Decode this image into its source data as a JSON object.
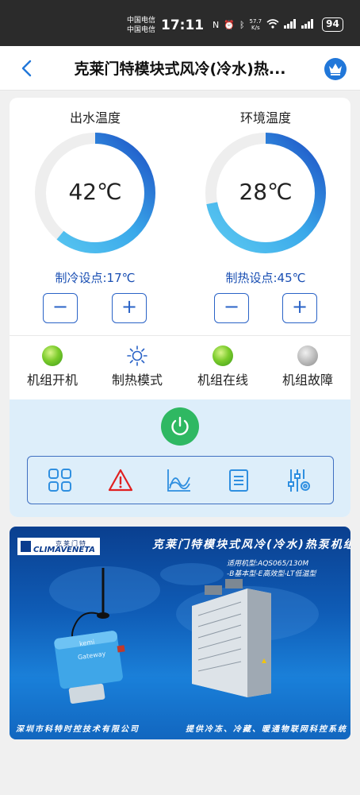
{
  "status_bar": {
    "carrier1": "中国电信",
    "carrier2": "中国电信",
    "time": "17:11",
    "net_speed_value": "57.7",
    "net_speed_unit": "K/s",
    "battery": "94"
  },
  "header": {
    "title": "克莱门特模块式风冷(冷水)热..."
  },
  "gauges": {
    "outlet": {
      "title": "出水温度",
      "value": "42℃",
      "level": 0.61,
      "setpoint_label": "制冷设点:17℃"
    },
    "ambient": {
      "title": "环境温度",
      "value": "28℃",
      "level": 0.72,
      "setpoint_label": "制热设点:45℃"
    },
    "minus_symbol": "−",
    "plus_symbol": "+"
  },
  "status": [
    {
      "label": "机组开机",
      "lamp": "green",
      "icon": "green-lamp-icon"
    },
    {
      "label": "制热模式",
      "lamp": "sun",
      "icon": "sun-icon"
    },
    {
      "label": "机组在线",
      "lamp": "green",
      "icon": "green-lamp-icon"
    },
    {
      "label": "机组故障",
      "lamp": "gray",
      "icon": "gray-lamp-icon"
    }
  ],
  "toolbar": {
    "items": [
      "grid-icon",
      "warning-icon",
      "chart-icon",
      "document-icon",
      "sliders-icon"
    ]
  },
  "banner": {
    "logo_cn": "克莱门特",
    "logo_en": "CLIMAVENETA",
    "title": "克莱门特模块式风冷(冷水)热泵机组",
    "model_line": "适用机型:AQS065/130M",
    "series_line": "-B基本型-E高效型-LT低温型",
    "device_brand": "kemi",
    "device_model": "Gateway",
    "footer_left": "深圳市科特时控技术有限公司",
    "footer_right": "提供冷冻、冷藏、暖通物联网科控系统"
  },
  "colors": {
    "accent_blue": "#2a63c7",
    "power_green": "#2fb862",
    "panel_bg": "#ddeefa",
    "warning_red": "#e02020"
  }
}
